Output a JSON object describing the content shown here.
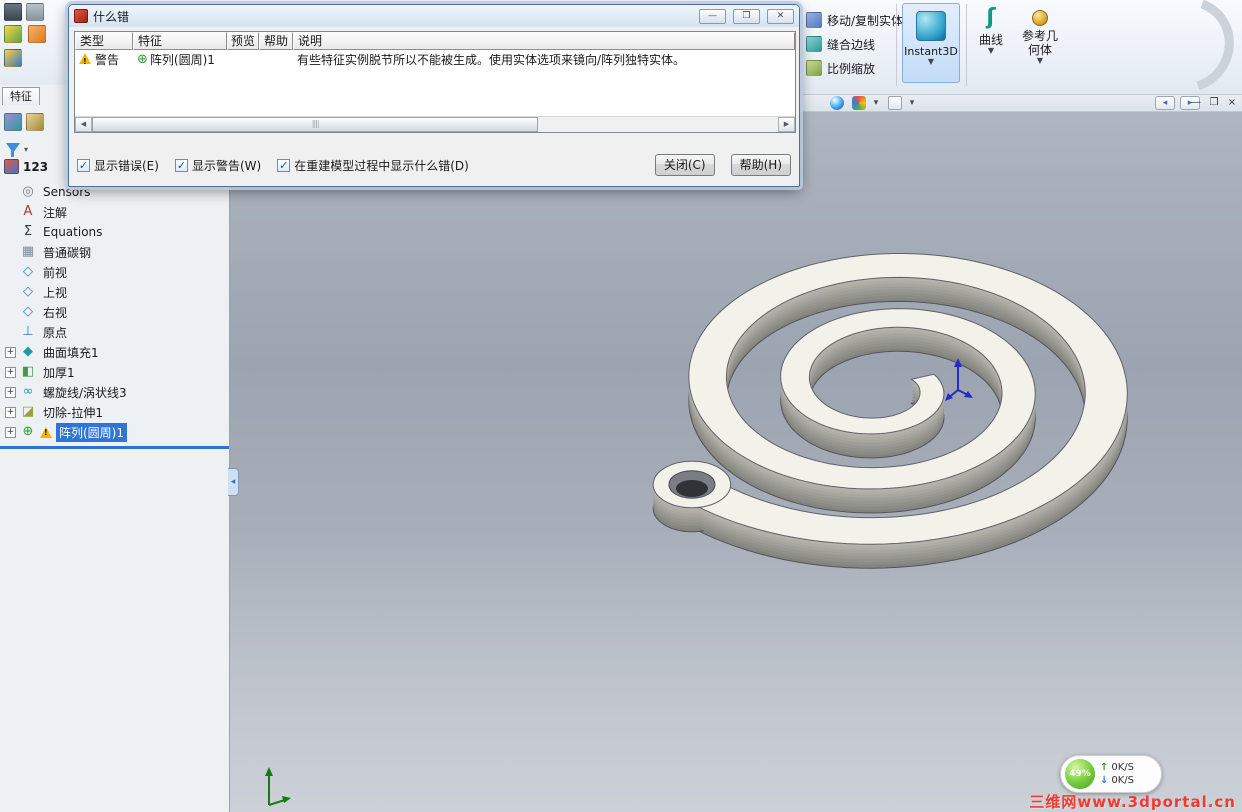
{
  "dialog": {
    "title": "什么错",
    "table": {
      "columns": [
        "类型",
        "特征",
        "预览",
        "帮助",
        "说明"
      ],
      "rows": [
        {
          "type": "警告",
          "feature": "阵列(圆周)1",
          "description": "有些特征实例脱节所以不能被生成。使用实体选项来镜向/阵列独特实体。"
        }
      ]
    },
    "checkboxes": [
      {
        "label": "显示错误(E)",
        "checked": true
      },
      {
        "label": "显示警告(W)",
        "checked": true
      },
      {
        "label": "在重建模型过程中显示什么错(D)",
        "checked": true
      }
    ],
    "close_button": "关闭(C)",
    "help_button": "帮助(H)"
  },
  "toolbar": {
    "move_copy": "移动/复制实体",
    "knit": "缝合边线",
    "scale": "比例缩放",
    "instant3d": "Instant3D",
    "curves": "曲线",
    "ref_geometry_line1": "参考几",
    "ref_geometry_line2": "何体"
  },
  "tree": {
    "tab": "特征",
    "root": "123",
    "items": [
      {
        "label": "Sensors",
        "icon": "sensors-icon"
      },
      {
        "label": "注解",
        "icon": "annotations-icon"
      },
      {
        "label": "Equations",
        "icon": "equations-icon"
      },
      {
        "label": "普通碳钢",
        "icon": "material-icon"
      },
      {
        "label": "前视",
        "icon": "plane-icon"
      },
      {
        "label": "上视",
        "icon": "plane-icon"
      },
      {
        "label": "右视",
        "icon": "plane-icon"
      },
      {
        "label": "原点",
        "icon": "origin-icon"
      },
      {
        "label": "曲面填充1",
        "icon": "surface-fill-icon",
        "expand": true
      },
      {
        "label": "加厚1",
        "icon": "thicken-icon",
        "expand": true
      },
      {
        "label": "螺旋线/涡状线3",
        "icon": "helix-icon",
        "expand": true
      },
      {
        "label": "切除-拉伸1",
        "icon": "cut-extrude-icon",
        "expand": true
      },
      {
        "label": "阵列(圆周)1",
        "icon": "circular-pattern-icon",
        "expand": true,
        "selected": true,
        "warning": true
      }
    ]
  },
  "status": {
    "percent": "49%",
    "up_speed": "0K/S",
    "down_speed": "0K/S"
  },
  "watermark": "三维网www.3dportal.cn",
  "colors": {
    "selection": "#2e75d5",
    "warning": "#f7b500",
    "watermark_red": "#f03b30",
    "viewport_top": "#bcc2cb",
    "viewport_mid": "#9ca4b1",
    "model_face": "#f2f1ea"
  }
}
